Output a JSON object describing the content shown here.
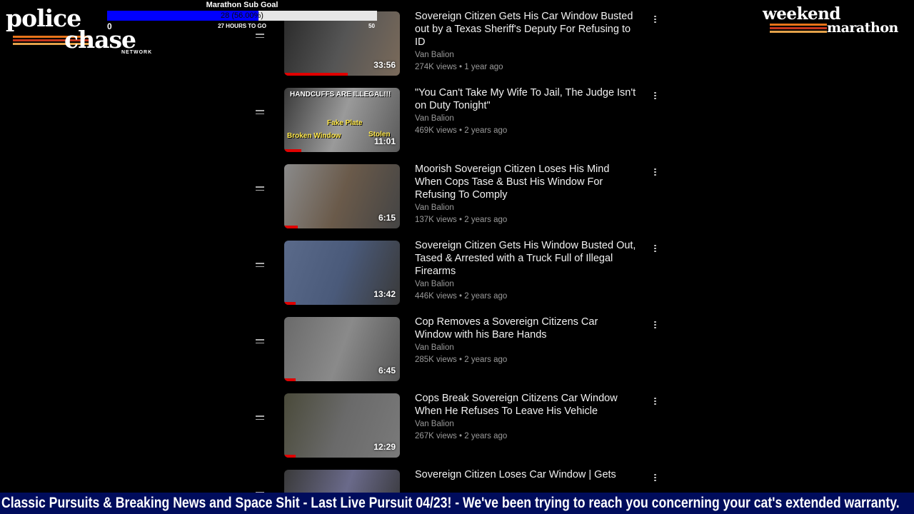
{
  "sub_goal": {
    "title": "Marathon Sub Goal",
    "progress_text": "28 (56.00%)",
    "progress_fraction": 0.56,
    "min_value": "0",
    "max_value": "50",
    "time_remaining": "27 HOURS TO GO"
  },
  "logo_left": {
    "line1": "police",
    "line2": "chase",
    "line3": "NETWORK"
  },
  "logo_right": {
    "line1": "weekend",
    "line2": "marathon"
  },
  "brand_colors": {
    "stripe_orange": "#e8741a",
    "stripe_red": "#c7361c",
    "stripe_tan": "#e4a24a",
    "progress_red": "#e00000",
    "goal_blue": "#0000ff",
    "ticker_bg": "#000c5c"
  },
  "playlist": {
    "items": [
      {
        "title": "Sovereign Citizen Gets His Car Window Busted out by a Texas Sheriff's Deputy For Refusing to ID",
        "channel": "Van Balion",
        "meta": "274K views • 1 year ago",
        "duration": "33:56",
        "watched_fraction": 0.55,
        "thumb_colors": [
          "#2a2a2a",
          "#555",
          "#7a6a5a"
        ]
      },
      {
        "title": "\"You Can't Take My Wife To Jail, The Judge Isn't on Duty Tonight\"",
        "channel": "Van Balion",
        "meta": "469K views • 2 years ago",
        "duration": "11:01",
        "watched_fraction": 0.15,
        "thumb_colors": [
          "#3a3a3a",
          "#9a9a9a",
          "#5a5a5a"
        ],
        "thumb_caption": "HANDCUFFS ARE ILLEGAL!!!",
        "thumb_labels": [
          "Broken Window",
          "Fake Plate",
          "Stolen"
        ]
      },
      {
        "title": "Moorish Sovereign Citizen Loses His Mind When Cops Tase & Bust His Window For Refusing To Comply",
        "channel": "Van Balion",
        "meta": "137K views • 2 years ago",
        "duration": "6:15",
        "watched_fraction": 0.12,
        "thumb_colors": [
          "#8a8a8a",
          "#6a5a4a",
          "#444"
        ]
      },
      {
        "title": "Sovereign Citizen Gets His Window Busted Out, Tased & Arrested with a Truck Full of Illegal Firearms",
        "channel": "Van Balion",
        "meta": "446K views • 2 years ago",
        "duration": "13:42",
        "watched_fraction": 0.1,
        "thumb_colors": [
          "#5a6a8a",
          "#4a5a7a",
          "#3a3a3a"
        ]
      },
      {
        "title": "Cop Removes a Sovereign Citizens Car Window with his Bare Hands",
        "channel": "Van Balion",
        "meta": "285K views • 2 years ago",
        "duration": "6:45",
        "watched_fraction": 0.1,
        "thumb_colors": [
          "#6a6a6a",
          "#8a8a8a",
          "#555"
        ]
      },
      {
        "title": "Cops Break Sovereign Citizens Car Window When He Refuses To Leave His Vehicle",
        "channel": "Van Balion",
        "meta": "267K views • 2 years ago",
        "duration": "12:29",
        "watched_fraction": 0.1,
        "thumb_colors": [
          "#4a4a3a",
          "#6a6a6a",
          "#7a7a7a"
        ]
      },
      {
        "title": "Sovereign Citizen Loses Car Window | Gets",
        "channel": "",
        "meta": "",
        "duration": "",
        "watched_fraction": 0,
        "thumb_colors": [
          "#3a3a3a",
          "#6a6a8a",
          "#333"
        ]
      }
    ]
  },
  "ticker": {
    "text": "Classic Pursuits & Breaking News and Space Shit - Last Live Pursuit 04/23! - We've been trying to reach you concerning your cat's extended warranty."
  }
}
